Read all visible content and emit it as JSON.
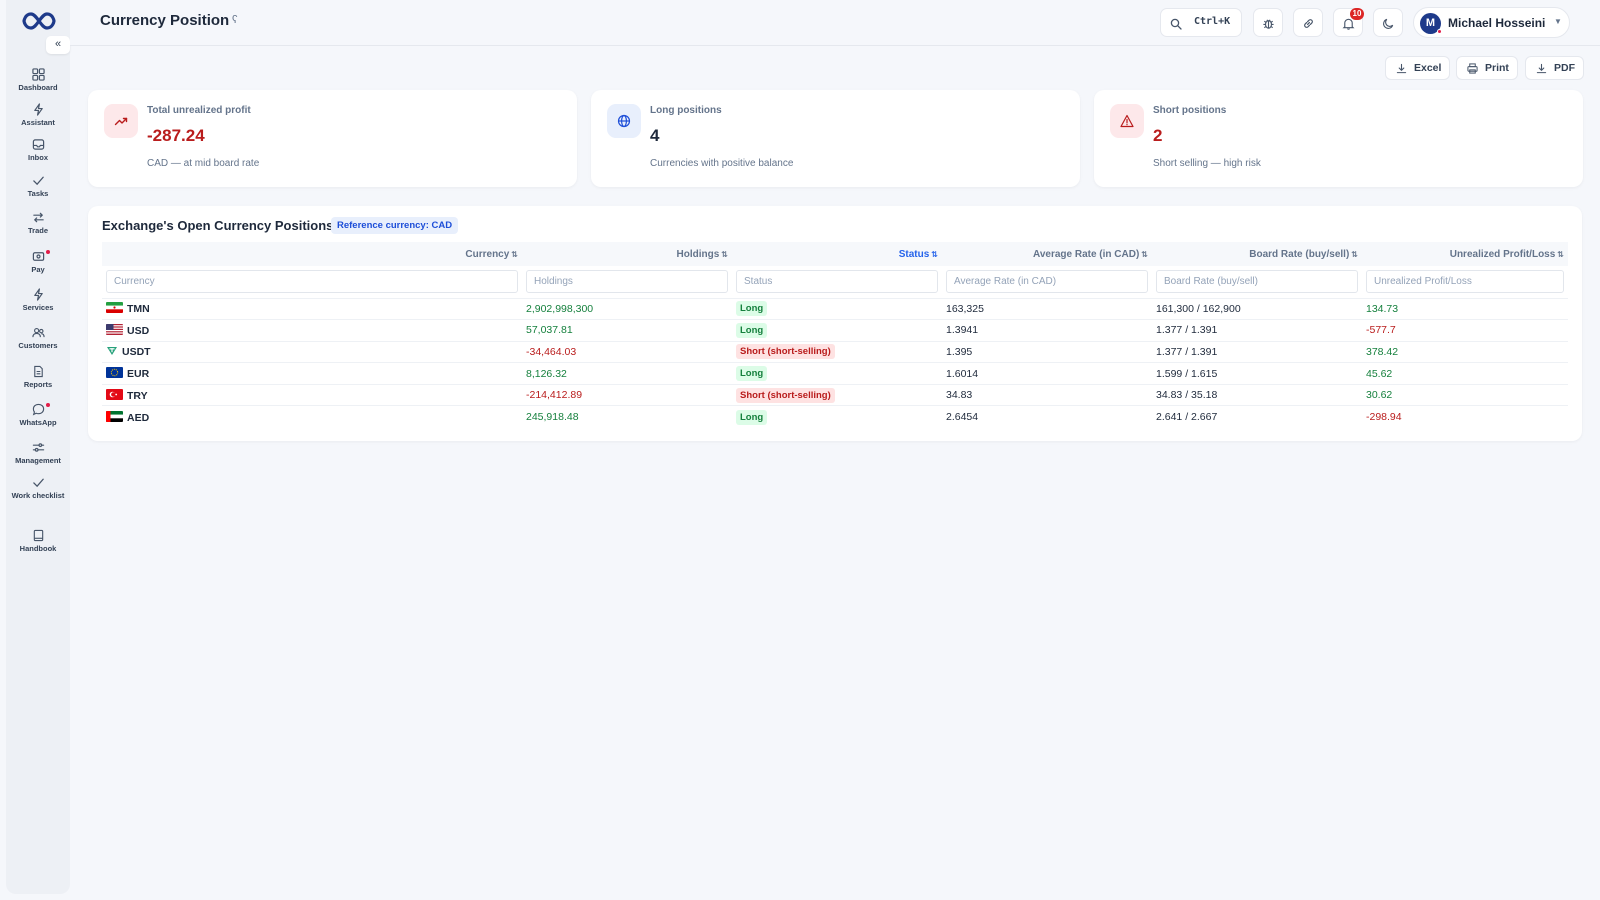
{
  "header": {
    "title": "Currency Position",
    "search_shortcut": "Ctrl+K",
    "notifications_count": "10",
    "user": {
      "initial": "M",
      "name": "Michael Hosseini"
    }
  },
  "sidebar": {
    "collapse_glyph": "«",
    "items": [
      {
        "label": "Dashboard",
        "icon": "dashboard-icon"
      },
      {
        "label": "Assistant",
        "icon": "bolt-icon"
      },
      {
        "label": "Inbox",
        "icon": "inbox-icon"
      },
      {
        "label": "Tasks",
        "icon": "check-icon"
      },
      {
        "label": "Trade",
        "icon": "arrows-icon"
      },
      {
        "label": "Pay",
        "icon": "wallet-icon",
        "dot": true
      },
      {
        "label": "Services",
        "icon": "bolt-icon"
      },
      {
        "label": "Customers",
        "icon": "users-icon"
      },
      {
        "label": "Reports",
        "icon": "document-icon"
      },
      {
        "label": "WhatsApp",
        "icon": "chat-icon",
        "dot": true
      },
      {
        "label": "Management",
        "icon": "sliders-icon"
      },
      {
        "label": "Work checklist",
        "icon": "check-icon"
      },
      {
        "label": "Handbook",
        "icon": "book-icon"
      }
    ]
  },
  "toolbar": {
    "excel_label": "Excel",
    "print_label": "Print",
    "pdf_label": "PDF"
  },
  "cards": [
    {
      "title": "Total unrealized profit",
      "value": "-287.24",
      "subtitle": "CAD — at mid board rate",
      "icon": "trend-up-icon",
      "accent": "#b91c1c"
    },
    {
      "title": "Long positions",
      "value": "4",
      "subtitle": "Currencies with positive balance",
      "icon": "globe-icon",
      "accent": "#1e293b"
    },
    {
      "title": "Short positions",
      "value": "2",
      "subtitle": "Short selling — high risk",
      "icon": "warning-icon",
      "accent": "#b91c1c"
    }
  ],
  "table": {
    "title": "Exchange's Open Currency Positions",
    "reference_badge": "Reference currency: CAD",
    "sort_glyph": "⇅",
    "columns": [
      "Currency",
      "Holdings",
      "Status",
      "Average Rate (in CAD)",
      "Board Rate (buy/sell)",
      "Unrealized Profit/Loss"
    ],
    "filter_placeholders": [
      "Currency",
      "Holdings",
      "Status",
      "Average Rate (in CAD)",
      "Board Rate (buy/sell)",
      "Unrealized Profit/Loss"
    ],
    "rows": [
      {
        "currency": "TMN",
        "flag": "iran",
        "holdings": "2,902,998,300",
        "status": "Long",
        "avg_rate": "163,325",
        "board_rate": "161,300 / 162,900",
        "pnl": "134.73"
      },
      {
        "currency": "USD",
        "flag": "usa",
        "holdings": "57,037.81",
        "status": "Long",
        "avg_rate": "1.3941",
        "board_rate": "1.377 / 1.391",
        "pnl": "-577.7"
      },
      {
        "currency": "USDT",
        "flag": "tether",
        "holdings": "-34,464.03",
        "status": "Short (short-selling)",
        "avg_rate": "1.395",
        "board_rate": "1.377 / 1.391",
        "pnl": "378.42"
      },
      {
        "currency": "EUR",
        "flag": "eu",
        "holdings": "8,126.32",
        "status": "Long",
        "avg_rate": "1.6014",
        "board_rate": "1.599 / 1.615",
        "pnl": "45.62"
      },
      {
        "currency": "TRY",
        "flag": "turkey",
        "holdings": "-214,412.89",
        "status": "Short (short-selling)",
        "avg_rate": "34.83",
        "board_rate": "34.83 / 35.18",
        "pnl": "30.62"
      },
      {
        "currency": "AED",
        "flag": "uae",
        "holdings": "245,918.48",
        "status": "Long",
        "avg_rate": "2.6454",
        "board_rate": "2.641 / 2.667",
        "pnl": "-298.94"
      }
    ]
  },
  "colors": {
    "positive": "#15803d",
    "negative": "#b91c1c",
    "accent": "#2563eb"
  }
}
